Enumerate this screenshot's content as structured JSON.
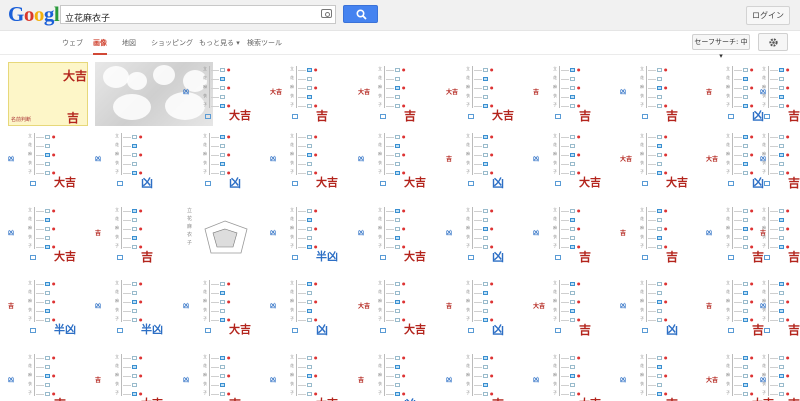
{
  "header": {
    "logo": [
      "G",
      "o",
      "o",
      "g",
      "l",
      "e"
    ],
    "query": "立花麻衣子",
    "login_label": "ログイン"
  },
  "nav": {
    "tabs": [
      {
        "label": "ウェブ",
        "active": false
      },
      {
        "label": "画像",
        "active": true
      },
      {
        "label": "地図",
        "active": false
      },
      {
        "label": "ショッピング",
        "active": false
      },
      {
        "label": "もっと見る ▾",
        "active": false
      },
      {
        "label": "検索ツール",
        "active": false
      }
    ],
    "safesearch_label": "セーフサーチ: 中 ▾"
  },
  "feature_caption": "名前判断",
  "columns": [
    "立",
    "花",
    "麻",
    "衣",
    "子"
  ],
  "fortunes": [
    "大吉",
    "吉",
    "凶",
    "半凶"
  ],
  "grid": {
    "rows": [
      [
        "feat1",
        "feat2",
        "大吉",
        "吉",
        "吉",
        "大吉",
        "吉",
        "吉",
        "凶",
        "吉"
      ],
      [
        "大吉",
        "凶",
        "凶",
        "大吉",
        "大吉",
        "凶",
        "大吉",
        "大吉",
        "凶",
        "吉"
      ],
      [
        "大吉",
        "吉",
        "chart",
        "半凶",
        "大吉",
        "凶",
        "吉",
        "吉",
        "吉",
        "吉"
      ],
      [
        "半凶",
        "半凶",
        "大吉",
        "凶",
        "大吉",
        "凶",
        "吉",
        "凶",
        "吉",
        "吉"
      ],
      [
        "吉",
        "大吉",
        "吉",
        "大吉",
        "凶",
        "吉",
        "大吉",
        "吉",
        "大吉",
        "吉"
      ]
    ],
    "side_marks": [
      [
        "",
        "",
        "凶",
        "大吉",
        "大吉",
        "大吉",
        "吉",
        "凶",
        "吉",
        "凶"
      ],
      [
        "凶",
        "凶",
        "",
        "凶",
        "凶",
        "吉",
        "凶",
        "大吉",
        "大吉",
        "凶"
      ],
      [
        "凶",
        "吉",
        "",
        "凶",
        "凶",
        "凶",
        "凶",
        "吉",
        "凶",
        "吉"
      ],
      [
        "吉",
        "凶",
        "凶",
        "凶",
        "大吉",
        "吉",
        "大吉",
        "凶",
        "吉",
        "凶"
      ],
      [
        "凶",
        "吉",
        "凶",
        "凶",
        "吉",
        "凶",
        "凶",
        "凶",
        "大吉",
        "凶"
      ]
    ]
  },
  "colors": {
    "accent": "#d14836",
    "search_blue": "#4583f0",
    "kichi_red": "#b3241c",
    "kyo_blue": "#2d6fc5"
  }
}
